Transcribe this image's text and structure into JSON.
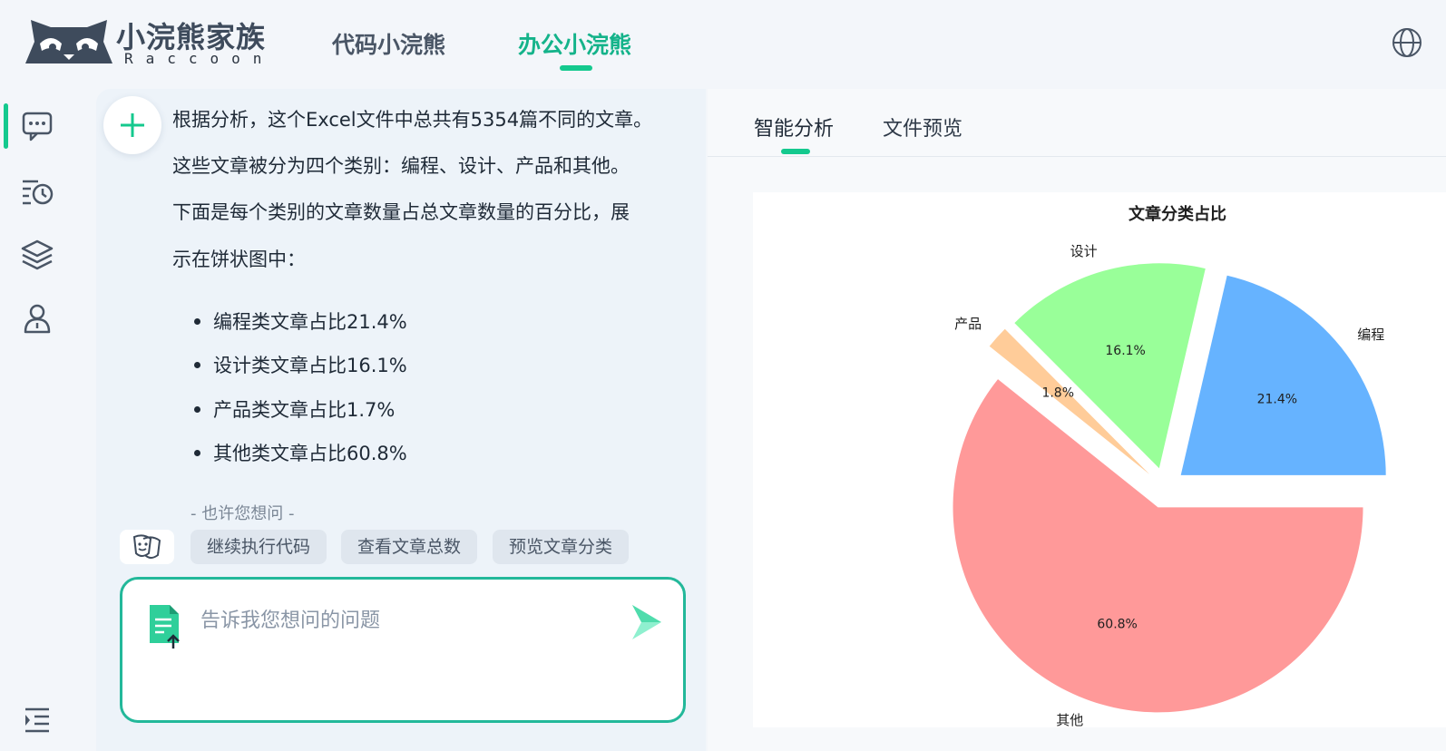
{
  "header": {
    "brand_name": "小浣熊家族",
    "brand_sub": "Raccoon",
    "tabs": [
      {
        "label": "代码小浣熊",
        "active": false
      },
      {
        "label": "办公小浣熊",
        "active": true
      }
    ]
  },
  "sidebar": {
    "icons": [
      "chat-bubble-icon",
      "history-icon",
      "layers-icon",
      "user-icon",
      "collapse-menu-icon"
    ]
  },
  "chat": {
    "message_lines": [
      "根据分析，这个Excel文件中总共有5354篇不同的文章。",
      "这些文章被分为四个类别：编程、设计、产品和其他。",
      "下面是每个类别的文章数量占总文章数量的百分比，展",
      "示在饼状图中："
    ],
    "bullets": [
      "编程类文章占比21.4%",
      "设计类文章占比16.1%",
      "产品类文章占比1.7%",
      "其他类文章占比60.8%"
    ],
    "suggest_title": "- 也许您想问 -",
    "suggestions": [
      "继续执行代码",
      "查看文章总数",
      "预览文章分类"
    ],
    "input": {
      "placeholder": "告诉我您想问的问题",
      "value": ""
    }
  },
  "panel": {
    "tabs": [
      {
        "label": "智能分析",
        "active": true
      },
      {
        "label": "文件预览",
        "active": false
      }
    ]
  },
  "chart_data": {
    "type": "pie",
    "title": "文章分类占比",
    "categories": [
      "编程",
      "设计",
      "产品",
      "其他"
    ],
    "values": [
      21.4,
      16.1,
      1.8,
      60.8
    ],
    "labels": [
      "21.4%",
      "16.1%",
      "1.8%",
      "60.8%"
    ],
    "colors": [
      "#66b3ff",
      "#99ff99",
      "#ffcc99",
      "#ff9999"
    ],
    "exploded": true,
    "start_angle_deg": 0,
    "direction": "counterclockwise"
  },
  "colors": {
    "accent": "#14c98e",
    "accent_text": "#14b38a",
    "input_border": "#23b89a"
  }
}
